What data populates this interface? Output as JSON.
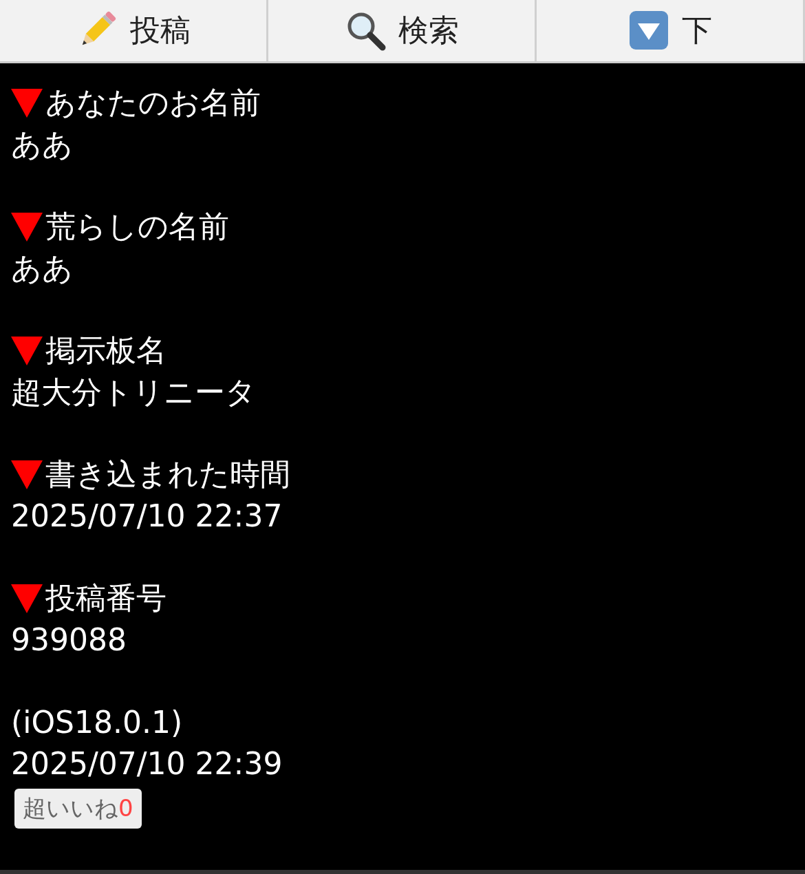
{
  "toolbar": [
    {
      "label": "投稿",
      "kind": "pencil"
    },
    {
      "label": "検索",
      "kind": "search"
    },
    {
      "label": "下",
      "kind": "down"
    }
  ],
  "fields": [
    {
      "label": "あなたのお名前",
      "value": "ああ"
    },
    {
      "label": "荒らしの名前",
      "value": "ああ"
    },
    {
      "label": "掲示板名",
      "value": "超大分トリニータ"
    },
    {
      "label": "書き込まれた時間",
      "value": "2025/07/10 22:37"
    },
    {
      "label": "投稿番号",
      "value": "939088"
    }
  ],
  "footer": {
    "device": "(iOS18.0.1)",
    "time": "2025/07/10 22:39",
    "like_button": {
      "label": "超いいね",
      "count": "0"
    }
  }
}
